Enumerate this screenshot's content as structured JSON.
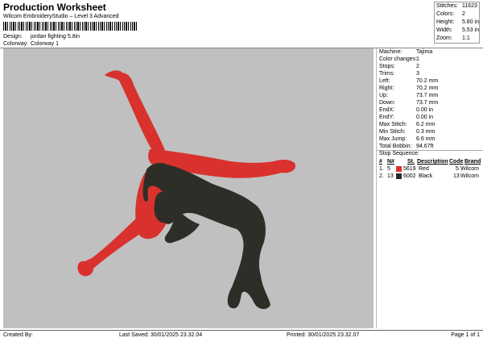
{
  "header": {
    "title": "Production Worksheet",
    "subtitle": "Wilcom EmbroideryStudio – Level 3 Advanced",
    "design_label": "Design:",
    "design_value": "jordan fighting 5.8in",
    "colorway_label": "Colorway:",
    "colorway_value": "Colorway 1"
  },
  "top_stats": [
    {
      "label": "Stitches:",
      "value": "11623"
    },
    {
      "label": "Colors:",
      "value": "2"
    },
    {
      "label": "Height:",
      "value": "5.80 in"
    },
    {
      "label": "Width:",
      "value": "5.53 in"
    },
    {
      "label": "Zoom:",
      "value": "1:1"
    }
  ],
  "machine_stats": [
    {
      "label": "Machine:",
      "value": "Tajima"
    },
    {
      "label": "Color changes:",
      "value": "1"
    },
    {
      "label": "Stops:",
      "value": "2"
    },
    {
      "label": "Trims:",
      "value": "3"
    },
    {
      "label": "Left:",
      "value": "70.2 mm"
    },
    {
      "label": "Right:",
      "value": "70.2 mm"
    },
    {
      "label": "Up:",
      "value": "73.7 mm"
    },
    {
      "label": "Down:",
      "value": "73.7 mm"
    },
    {
      "label": "EndX:",
      "value": "0.00 in"
    },
    {
      "label": "EndY:",
      "value": "0.00 in"
    },
    {
      "label": "Max Stitch:",
      "value": "6.2 mm"
    },
    {
      "label": "Min Stitch:",
      "value": "0.3 mm"
    },
    {
      "label": "Max Jump:",
      "value": "6.6 mm"
    },
    {
      "label": "Total Bobbin:",
      "value": "94.67ft"
    }
  ],
  "stop_sequence": {
    "title": "Stop Sequence:",
    "headers": [
      "#",
      "N#",
      "St.",
      "Description",
      "Code",
      "Brand"
    ],
    "rows": [
      {
        "num": "1.",
        "n": "5",
        "st": "5619",
        "color": "#d9322e",
        "description": "Red",
        "code": "5",
        "brand": "Wilcom"
      },
      {
        "num": "2.",
        "n": "13",
        "st": "6002",
        "color": "#2a2a25",
        "description": "Black",
        "code": "13",
        "brand": "Wilcom"
      }
    ]
  },
  "colors": {
    "red_figure": "#d9322e",
    "black_figure": "#2e2e28",
    "background": "#c0c0c0"
  },
  "footer": {
    "created_by": "Created By:",
    "last_saved": "Last Saved: 30/01/2025 23.32.04",
    "printed": "Printed: 30/01/2025 23.32.07",
    "page": "Page 1 of 1"
  }
}
